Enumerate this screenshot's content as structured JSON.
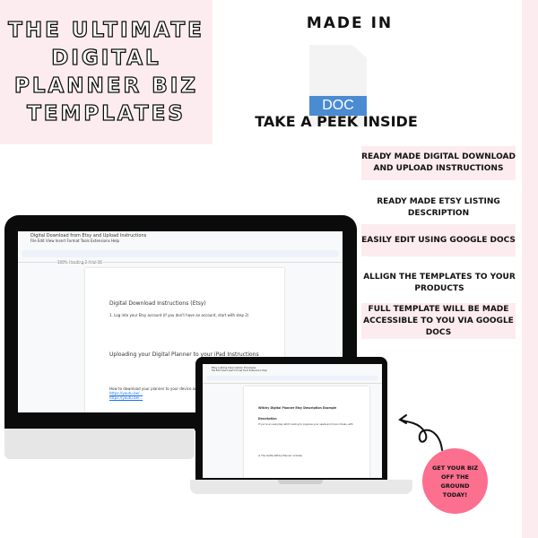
{
  "title_lines": [
    "THE ULTIMATE",
    "DIGITAL",
    "PLANNER BIZ",
    "TEMPLATES"
  ],
  "made_in": "MADE IN",
  "doc_label": "DOC",
  "peek": "TAKE A PEEK INSIDE",
  "features": [
    {
      "text": "READY MADE DIGITAL DOWNLOAD AND UPLOAD INSTRUCTIONS",
      "highlight": true
    },
    {
      "text": "READY MADE ETSY LISTING DESCRIPTION",
      "highlight": false
    },
    {
      "text": "EASILY EDIT USING GOOGLE DOCS",
      "highlight": true
    },
    {
      "text": "ALLIGN THE TEMPLATES TO YOUR PRODUCTS",
      "highlight": false
    },
    {
      "text": "FULL TEMPLATE WILL BE MADE ACCESSIBLE  TO YOU VIA GOOGLE DOCS",
      "highlight": true
    }
  ],
  "monitor_doc": {
    "title": "Digital Download from Etsy and Upload Instructions",
    "menu": "File  Edit  View  Insert  Format  Tools  Extensions  Help",
    "toolbar": "100%   Heading 2   Arial   16",
    "heading1": "Digital Download Instructions (Etsy)",
    "step1": "1. Log into your Etsy account (if you don't have an account, start with step 2)",
    "heading2": "Uploading your Digital Planner to your iPad Instructions",
    "para": "How to download your planner to your device and im",
    "link1": "https://youtu.be/...",
    "link2": "https://youtu.be/..."
  },
  "laptop_doc": {
    "title": "Etsy Listing Description Example",
    "menu": "File  Edit  View  Insert  Format  Tools  Extensions  Help",
    "heading": "Witchy Digital Planner Etsy Description Example",
    "subheading": "Description",
    "para": "If you're an everyday witch looking to organise your spells and moon rituals, with",
    "bullet": "★ The Ioethe Witchy Planner  includes"
  },
  "cta": "GET YOUR BIZ OFF THE GROUND TODAY!",
  "colors": {
    "pink_bg": "#fdecef",
    "cta_pink": "#fc6f8f",
    "doc_blue": "#4a8bd1"
  }
}
